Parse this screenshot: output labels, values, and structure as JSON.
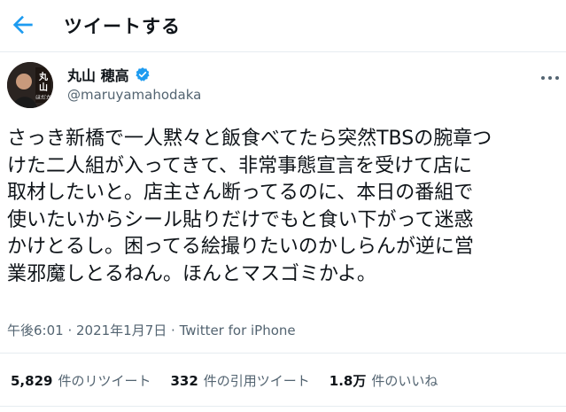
{
  "header": {
    "title": "ツイートする"
  },
  "author": {
    "name": "丸山 穂高",
    "handle": "@maruyamahodaka",
    "avatar_text": "丸山ほだか"
  },
  "tweet": {
    "text": "さっき新橋で一人黙々と飯食べてたら突然TBSの腕章つ\nけた二人組が入ってきて、非常事態宣言を受けて店に\n取材したいと。店主さん断ってるのに、本日の番組で\n使いたいからシール貼りだけでもと食い下がって迷惑\nかけとるし。困ってる絵撮りたいのかしらんが逆に営\n業邪魔しとるねん。ほんとマスゴミかよ。",
    "time": "午後6:01",
    "sep1": " · ",
    "date": "2021年1月7日",
    "sep2": " · ",
    "client": "Twitter for iPhone"
  },
  "stats": {
    "retweets_count": "5,829",
    "retweets_label": "件のリツイート",
    "quotes_count": "332",
    "quotes_label": "件の引用ツイート",
    "likes_count": "1.8万",
    "likes_label": "件のいいね"
  },
  "colors": {
    "accent": "#1d9bf0",
    "secondary_text": "#536471",
    "divider": "#e6ecf0"
  },
  "icons": {
    "back": "arrow-left-icon",
    "verified": "verified-badge-icon",
    "more": "more-horizontal-icon"
  }
}
